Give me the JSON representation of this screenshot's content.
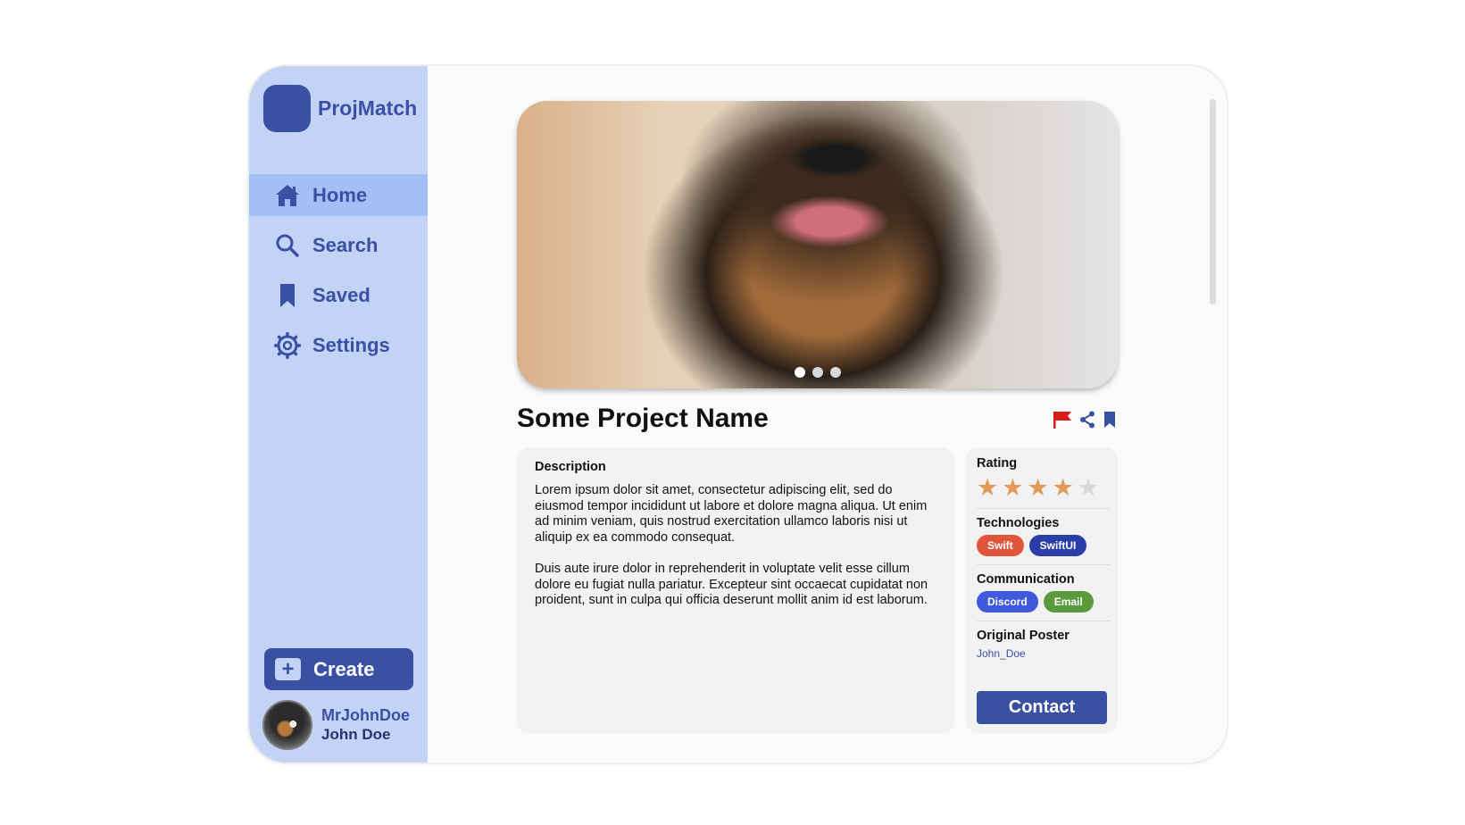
{
  "app": {
    "name": "ProjMatch"
  },
  "nav": {
    "items": [
      {
        "label": "Home",
        "icon": "home-icon",
        "active": true
      },
      {
        "label": "Search",
        "icon": "search-icon",
        "active": false
      },
      {
        "label": "Saved",
        "icon": "bookmark-icon",
        "active": false
      },
      {
        "label": "Settings",
        "icon": "gear-icon",
        "active": false
      }
    ]
  },
  "create": {
    "label": "Create"
  },
  "user": {
    "handle": "MrJohnDoe",
    "name": "John Doe"
  },
  "carousel": {
    "slides": 3,
    "active_index": 0
  },
  "project": {
    "title": "Some Project Name",
    "description_heading": "Description",
    "description_paragraphs": [
      "Lorem ipsum dolor sit amet, consectetur adipiscing elit, sed do eiusmod tempor incididunt ut labore et dolore magna aliqua. Ut enim ad minim veniam, quis nostrud exercitation ullamco laboris nisi ut aliquip ex ea commodo consequat.",
      "Duis aute irure dolor in reprehenderit in voluptate velit esse cillum dolore eu fugiat nulla pariatur. Excepteur sint occaecat cupidatat non proident, sunt in culpa qui officia deserunt mollit anim id est laborum."
    ]
  },
  "info": {
    "rating_label": "Rating",
    "rating_value": 4,
    "rating_max": 5,
    "technologies_label": "Technologies",
    "technologies": [
      {
        "label": "Swift",
        "color": "#e2553d"
      },
      {
        "label": "SwiftUI",
        "color": "#2a3ea8"
      }
    ],
    "communication_label": "Communication",
    "communication": [
      {
        "label": "Discord",
        "color": "#3f58dd"
      },
      {
        "label": "Email",
        "color": "#5a9a3c"
      }
    ],
    "poster_label": "Original Poster",
    "poster_name": "John_Doe",
    "contact_label": "Contact"
  },
  "colors": {
    "primary": "#3a51a3",
    "sidebar": "#c3d3f5",
    "sidebar_active": "#a3bff5",
    "flag": "#d81c1c"
  }
}
